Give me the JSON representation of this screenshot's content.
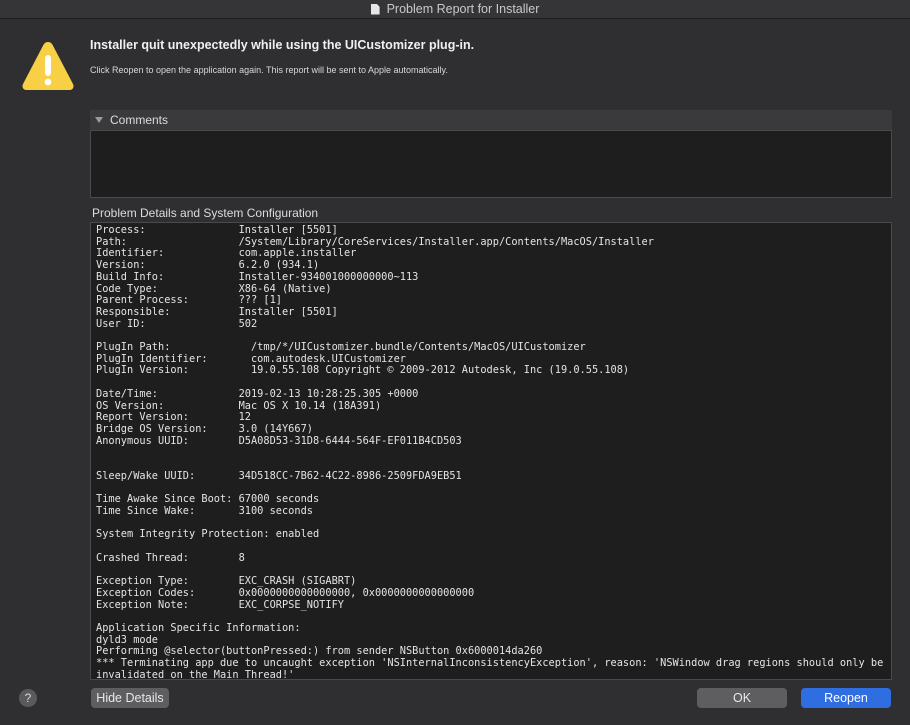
{
  "window": {
    "title": "Problem Report for Installer",
    "title_icon": "document-icon"
  },
  "alert": {
    "icon": "warning-icon",
    "icon_color": "#f7d046",
    "headline": "Installer quit unexpectedly while using the UICustomizer plug-in.",
    "message": "Click Reopen to open the application again. This report will be sent to Apple automatically."
  },
  "comments": {
    "label": "Comments",
    "disclosure_icon": "disclosure-triangle-icon",
    "value": ""
  },
  "details": {
    "label": "Problem Details and System Configuration",
    "text": "Process:               Installer [5501]\nPath:                  /System/Library/CoreServices/Installer.app/Contents/MacOS/Installer\nIdentifier:            com.apple.installer\nVersion:               6.2.0 (934.1)\nBuild Info:            Installer-934001000000000~113\nCode Type:             X86-64 (Native)\nParent Process:        ??? [1]\nResponsible:           Installer [5501]\nUser ID:               502\n\nPlugIn Path:             /tmp/*/UICustomizer.bundle/Contents/MacOS/UICustomizer\nPlugIn Identifier:       com.autodesk.UICustomizer\nPlugIn Version:          19.0.55.108 Copyright © 2009-2012 Autodesk, Inc (19.0.55.108)\n\nDate/Time:             2019-02-13 10:28:25.305 +0000\nOS Version:            Mac OS X 10.14 (18A391)\nReport Version:        12\nBridge OS Version:     3.0 (14Y667)\nAnonymous UUID:        D5A08D53-31D8-6444-564F-EF011B4CD503\n\n\nSleep/Wake UUID:       34D518CC-7B62-4C22-8986-2509FDA9EB51\n\nTime Awake Since Boot: 67000 seconds\nTime Since Wake:       3100 seconds\n\nSystem Integrity Protection: enabled\n\nCrashed Thread:        8\n\nException Type:        EXC_CRASH (SIGABRT)\nException Codes:       0x0000000000000000, 0x0000000000000000\nException Note:        EXC_CORPSE_NOTIFY\n\nApplication Specific Information:\ndyld3 mode\nPerforming @selector(buttonPressed:) from sender NSButton 0x6000014da260\n*** Terminating app due to uncaught exception 'NSInternalInconsistencyException', reason: 'NSWindow drag regions should only be\ninvalidated on the Main Thread!'\nterminating with uncaught exception of type NSException"
  },
  "footer": {
    "help_label": "?",
    "hide_details_label": "Hide Details",
    "ok_label": "OK",
    "reopen_label": "Reopen",
    "accent_color": "#2f6ee0"
  }
}
